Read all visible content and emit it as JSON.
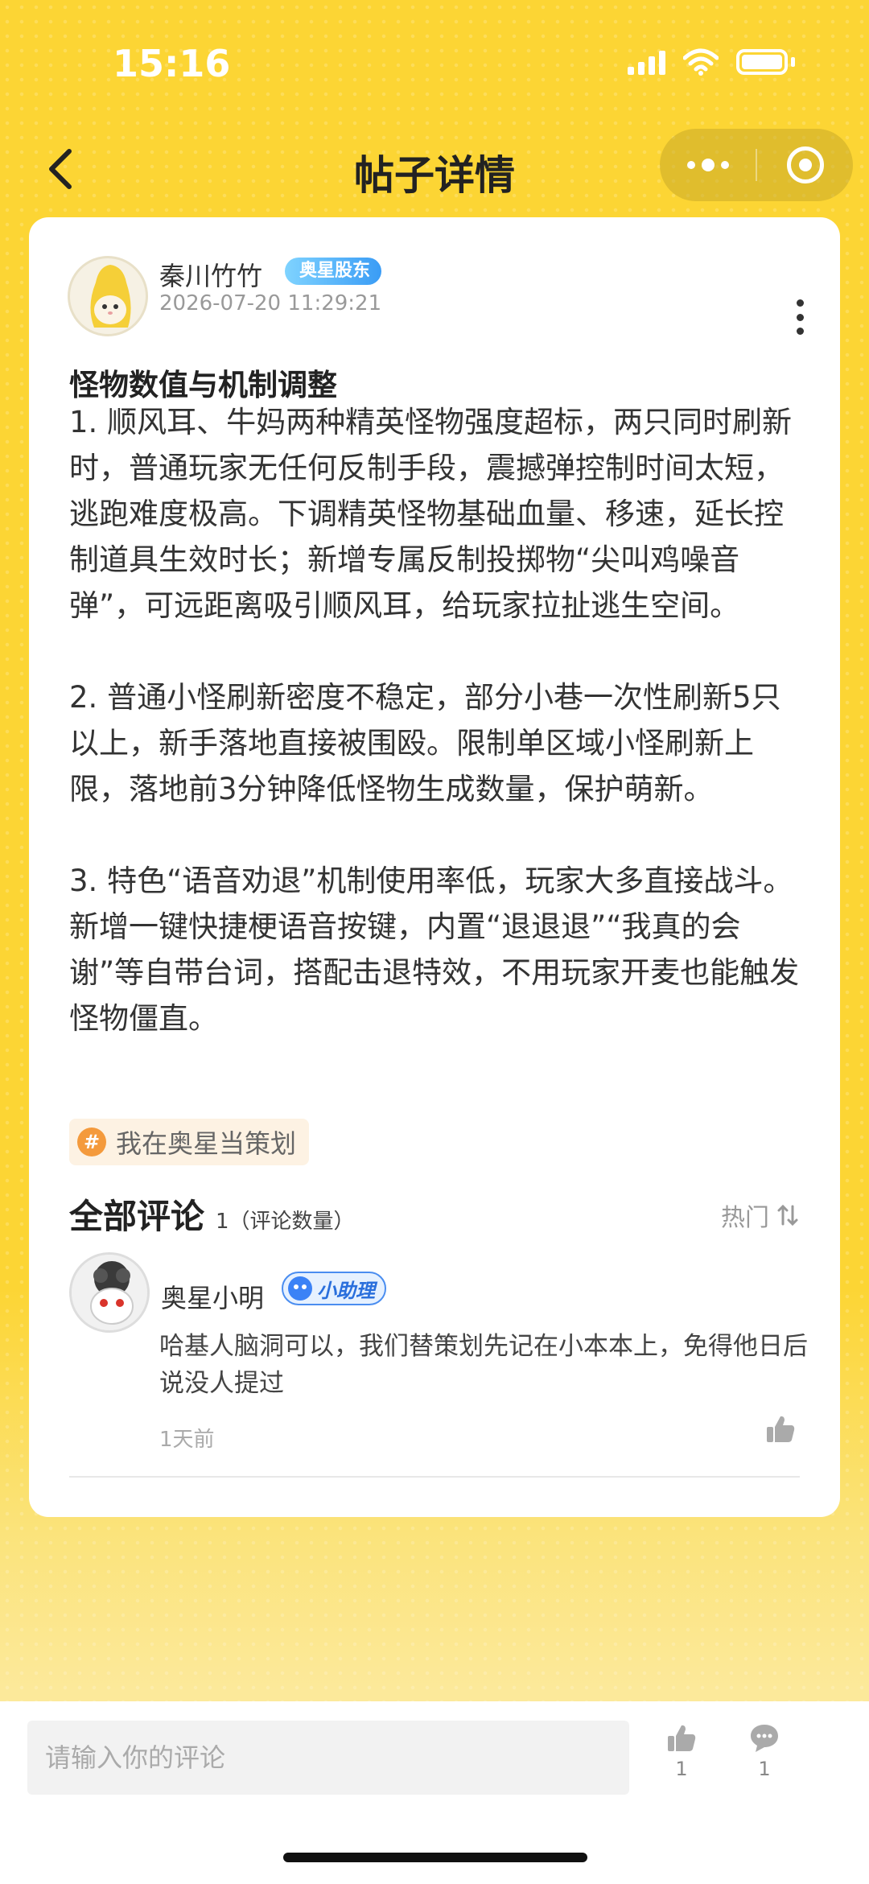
{
  "status_bar": {
    "time": "15:16"
  },
  "nav": {
    "title": "帖子详情"
  },
  "post": {
    "author": "秦川竹竹",
    "author_badge": "奥星股东",
    "timestamp": "2026-07-20 11:29:21",
    "title": "怪物数值与机制调整",
    "paragraphs": [
      "1. 顺风耳、牛妈两种精英怪物强度超标，两只同时刷新时，普通玩家无任何反制手段，震撼弹控制时间太短，逃跑难度极高。下调精英怪物基础血量、移速，延长控制道具生效时长；新增专属反制投掷物“尖叫鸡噪音弹”，可远距离吸引顺风耳，给玩家拉扯逃生空间。",
      "2. 普通小怪刷新密度不稳定，部分小巷一次性刷新5只以上，新手落地直接被围殴。限制单区域小怪刷新上限，落地前3分钟降低怪物生成数量，保护萌新。",
      "3. 特色“语音劝退”机制使用率低，玩家大多直接战斗。新增一键快捷梗语音按键，内置“退退退”“我真的会谢”等自带台词，搭配击退特效，不用玩家开麦也能触发怪物僵直。"
    ],
    "topic_icon": "#",
    "topic": "我在奥星当策划"
  },
  "comments": {
    "title": "全部评论",
    "count_label": "1（评论数量）",
    "sort_label": "热门",
    "items": [
      {
        "author": "奥星小明",
        "badge": "小助理",
        "text": "哈基人脑洞可以，我们替策划先记在小本本上，免得他日后说没人提过",
        "time": "1天前"
      }
    ]
  },
  "bottom_bar": {
    "input_placeholder": "请输入你的评论",
    "like_count": "1",
    "comment_count": "1"
  },
  "colors": {
    "background": "#fcd534",
    "badge_blue": "#3a9cf5",
    "topic_orange": "#f49a3c"
  }
}
